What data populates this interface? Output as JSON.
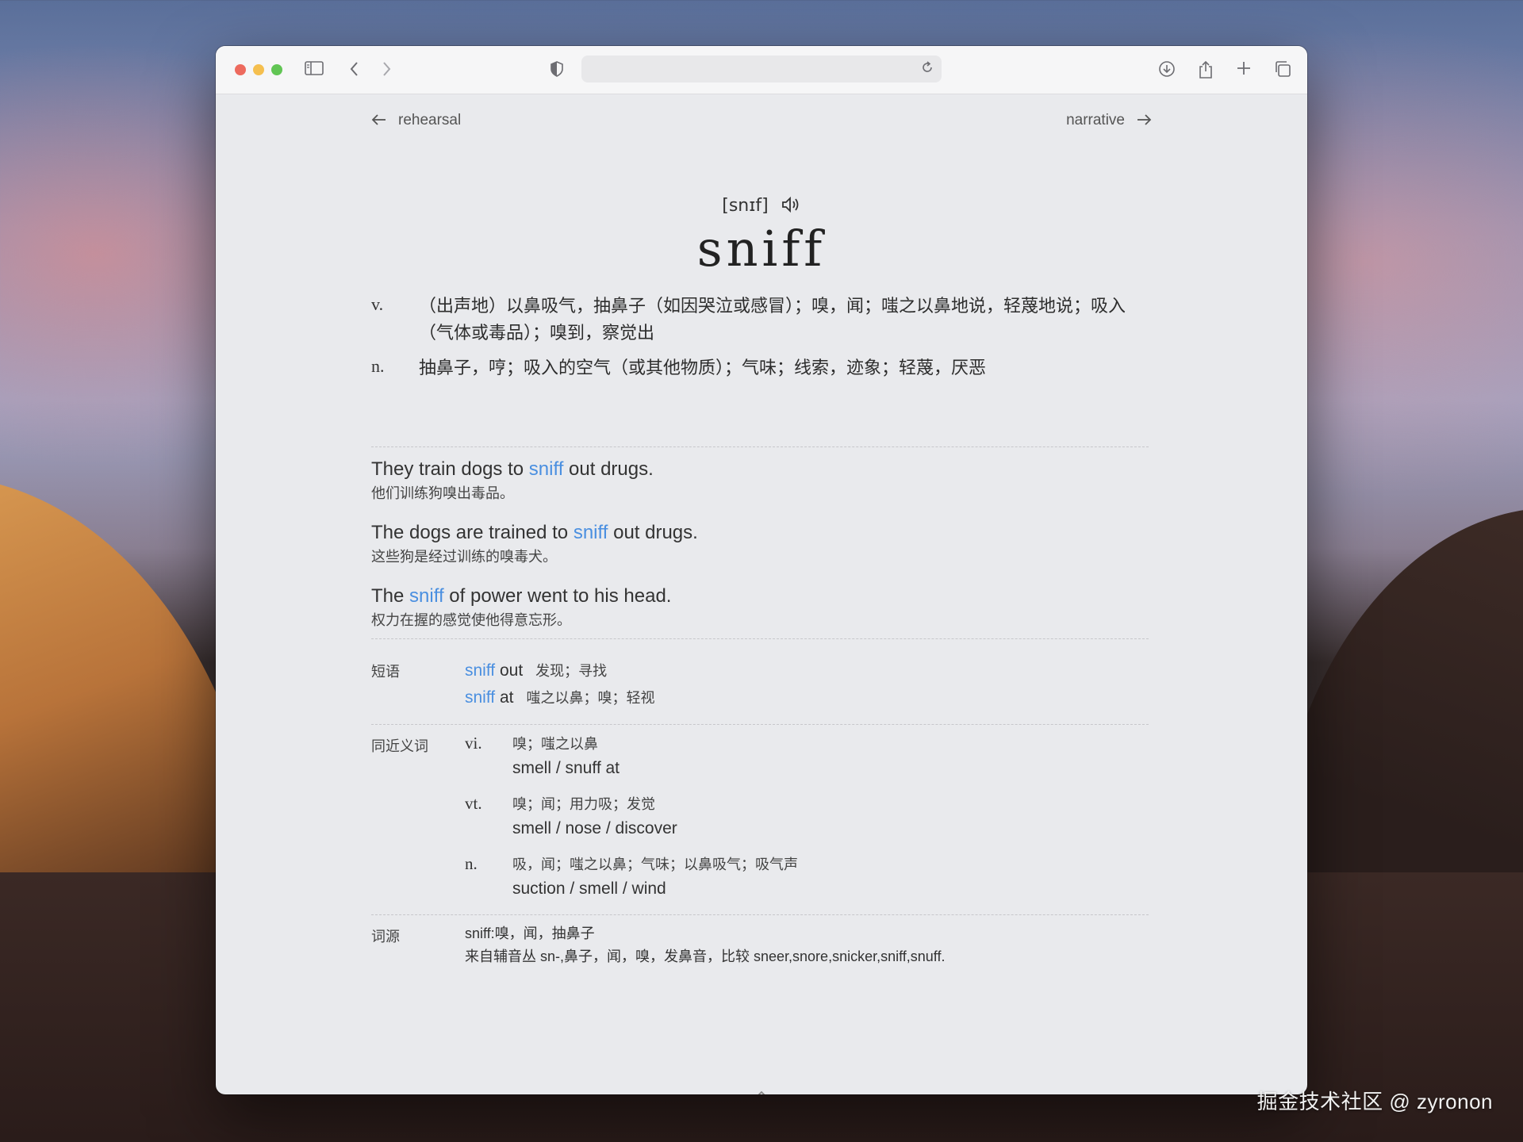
{
  "toolbar": {
    "sidebar_icon": "sidebar-icon",
    "back_icon": "chevron-left-icon",
    "forward_icon": "chevron-right-icon",
    "shield_icon": "shield-icon",
    "reload_icon": "reload-icon",
    "download_icon": "download-icon",
    "share_icon": "share-icon",
    "new_tab_icon": "plus-icon",
    "tabs_icon": "tabs-overview-icon",
    "url_value": ""
  },
  "nav": {
    "prev_word": "rehearsal",
    "next_word": "narrative"
  },
  "entry": {
    "phonetic": "[snɪf]",
    "word": "sniff",
    "definitions": [
      {
        "pos": "v.",
        "text": "（出声地）以鼻吸气，抽鼻子（如因哭泣或感冒）；嗅，闻；嗤之以鼻地说，轻蔑地说；吸入（气体或毒品）；嗅到，察觉出"
      },
      {
        "pos": "n.",
        "text": "抽鼻子，哼；吸入的空气（或其他物质）；气味；线索，迹象；轻蔑，厌恶"
      }
    ],
    "examples": [
      {
        "before": "They train dogs to ",
        "hl": "sniff",
        "after": " out drugs.",
        "cn": "他们训练狗嗅出毒品。"
      },
      {
        "before": "The dogs are trained to ",
        "hl": "sniff",
        "after": " out drugs.",
        "cn": "这些狗是经过训练的嗅毒犬。"
      },
      {
        "before": "The ",
        "hl": "sniff",
        "after": " of power went to his head.",
        "cn": "权力在握的感觉使他得意忘形。"
      }
    ],
    "phrases": {
      "label": "短语",
      "items": [
        {
          "hl": "sniff",
          "rest": " out",
          "cn": "发现；寻找"
        },
        {
          "hl": "sniff",
          "rest": " at",
          "cn": "嗤之以鼻；嗅；轻视"
        }
      ]
    },
    "synonyms": {
      "label": "同近义词",
      "groups": [
        {
          "pos": "vi.",
          "cn": "嗅；嗤之以鼻",
          "en": "smell / snuff at"
        },
        {
          "pos": "vt.",
          "cn": "嗅；闻；用力吸；发觉",
          "en": "smell / nose / discover"
        },
        {
          "pos": "n.",
          "cn": "吸，闻；嗤之以鼻；气味；以鼻吸气；吸气声",
          "en": "suction / smell / wind"
        }
      ]
    },
    "etymology": {
      "label": "词源",
      "line1": "sniff:嗅，闻，抽鼻子",
      "line2": "来自辅音丛 sn-,鼻子，闻，嗅，发鼻音，比较 sneer,snore,snicker,sniff,snuff."
    }
  },
  "progress": {
    "value": 0.3
  },
  "watermark": "掘金技术社区 @ zyronon",
  "colors": {
    "accent": "#4a8fe0"
  }
}
